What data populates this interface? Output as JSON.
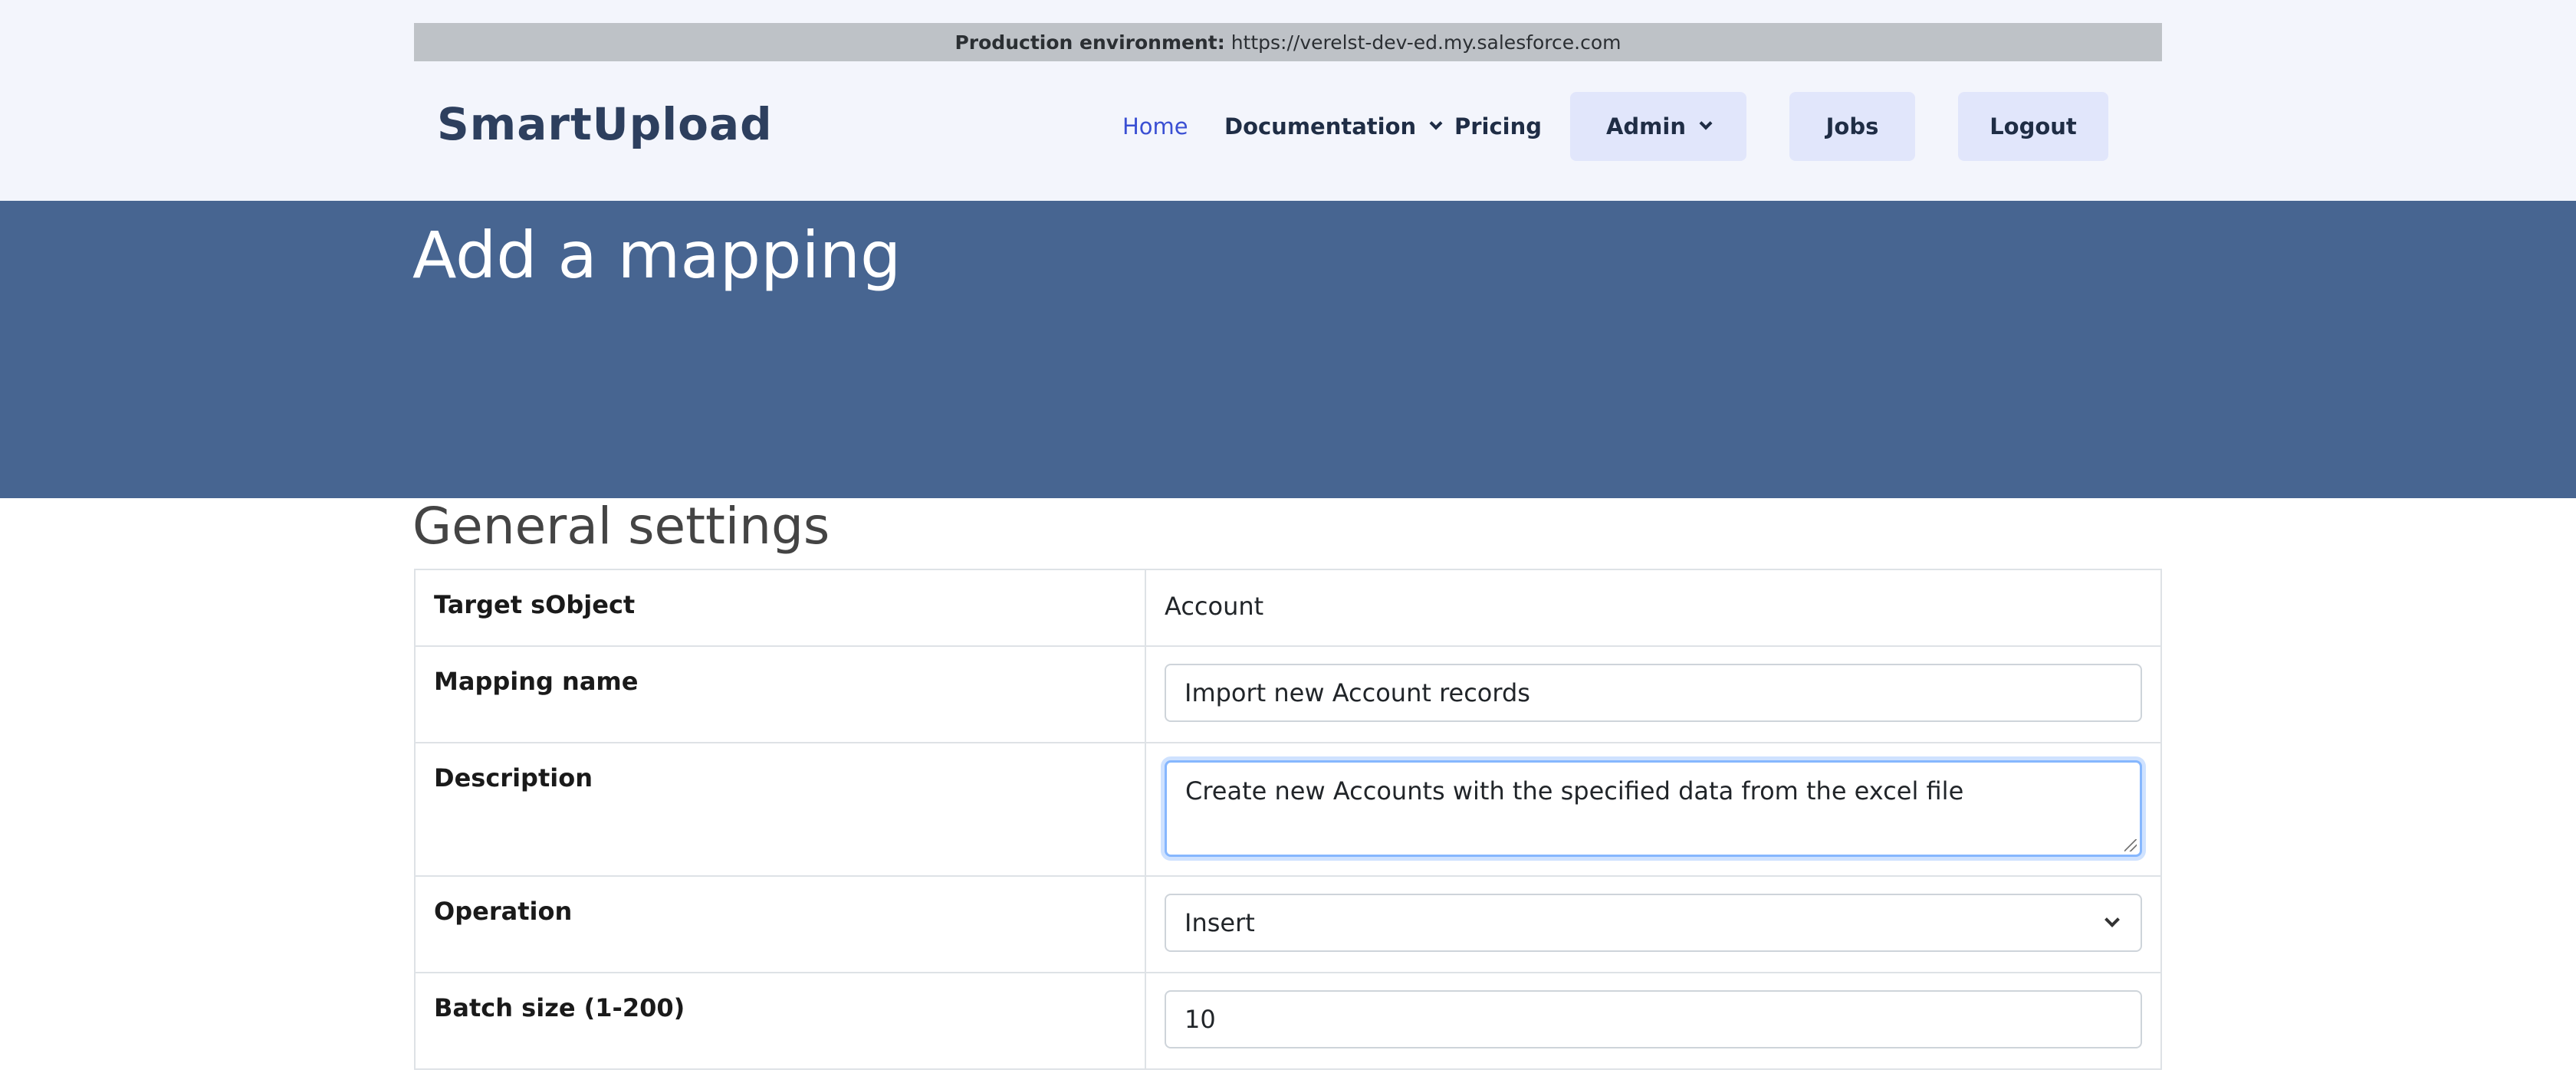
{
  "env_banner": {
    "label": "Production environment:",
    "url": "https://verelst-dev-ed.my.salesforce.com"
  },
  "brand": {
    "name": "SmartUpload"
  },
  "nav": {
    "home": "Home",
    "documentation": "Documentation",
    "pricing": "Pricing",
    "admin": "Admin",
    "jobs": "Jobs",
    "logout": "Logout"
  },
  "hero": {
    "title": "Add a mapping"
  },
  "general_settings": {
    "title": "General settings",
    "rows": {
      "target": {
        "label": "Target sObject",
        "value": "Account"
      },
      "mapping_name": {
        "label": "Mapping name",
        "value": "Import new Account records"
      },
      "description": {
        "label": "Description",
        "value": "Create new Accounts with the specified data from the excel file"
      },
      "operation": {
        "label": "Operation",
        "value": "Insert"
      },
      "batch_size": {
        "label": "Batch size (1-200)",
        "value": "10"
      }
    }
  },
  "colors": {
    "hero_bg": "#476591",
    "header_bg": "#f3f5fc",
    "active_link": "#3a4fd3",
    "nav_button_bg": "#e1e6fb"
  },
  "icons": {
    "dropdown": "chevron-down-icon",
    "resize": "resize-grip-icon"
  }
}
